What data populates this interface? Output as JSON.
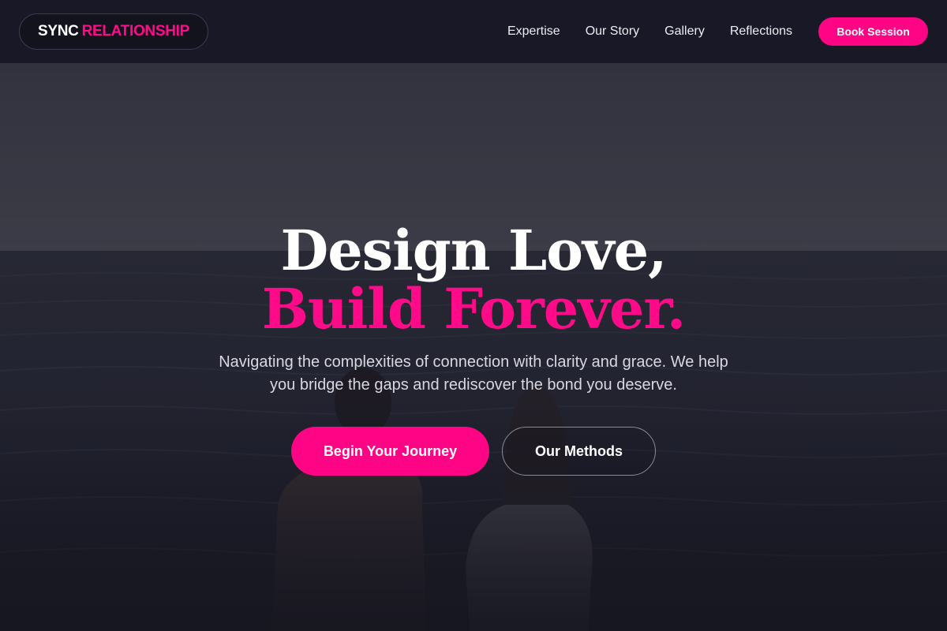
{
  "brand": {
    "part1": "SYNC",
    "part2": "RELATIONSHIP"
  },
  "nav": {
    "items": [
      "Expertise",
      "Our Story",
      "Gallery",
      "Reflections"
    ],
    "book_label": "Book Session"
  },
  "hero": {
    "headline_line1": "Design Love,",
    "headline_line2": "Build Forever.",
    "subtitle": "Navigating the complexities of connection with clarity and grace. We help you bridge the gaps and rediscover the bond you deserve.",
    "primary_cta": "Begin Your Journey",
    "secondary_cta": "Our Methods",
    "background_image": "couple-sitting-by-the-sea"
  },
  "colors": {
    "accent": "#ff0585",
    "header_bg": "#181826",
    "text_light": "#ffffff"
  }
}
